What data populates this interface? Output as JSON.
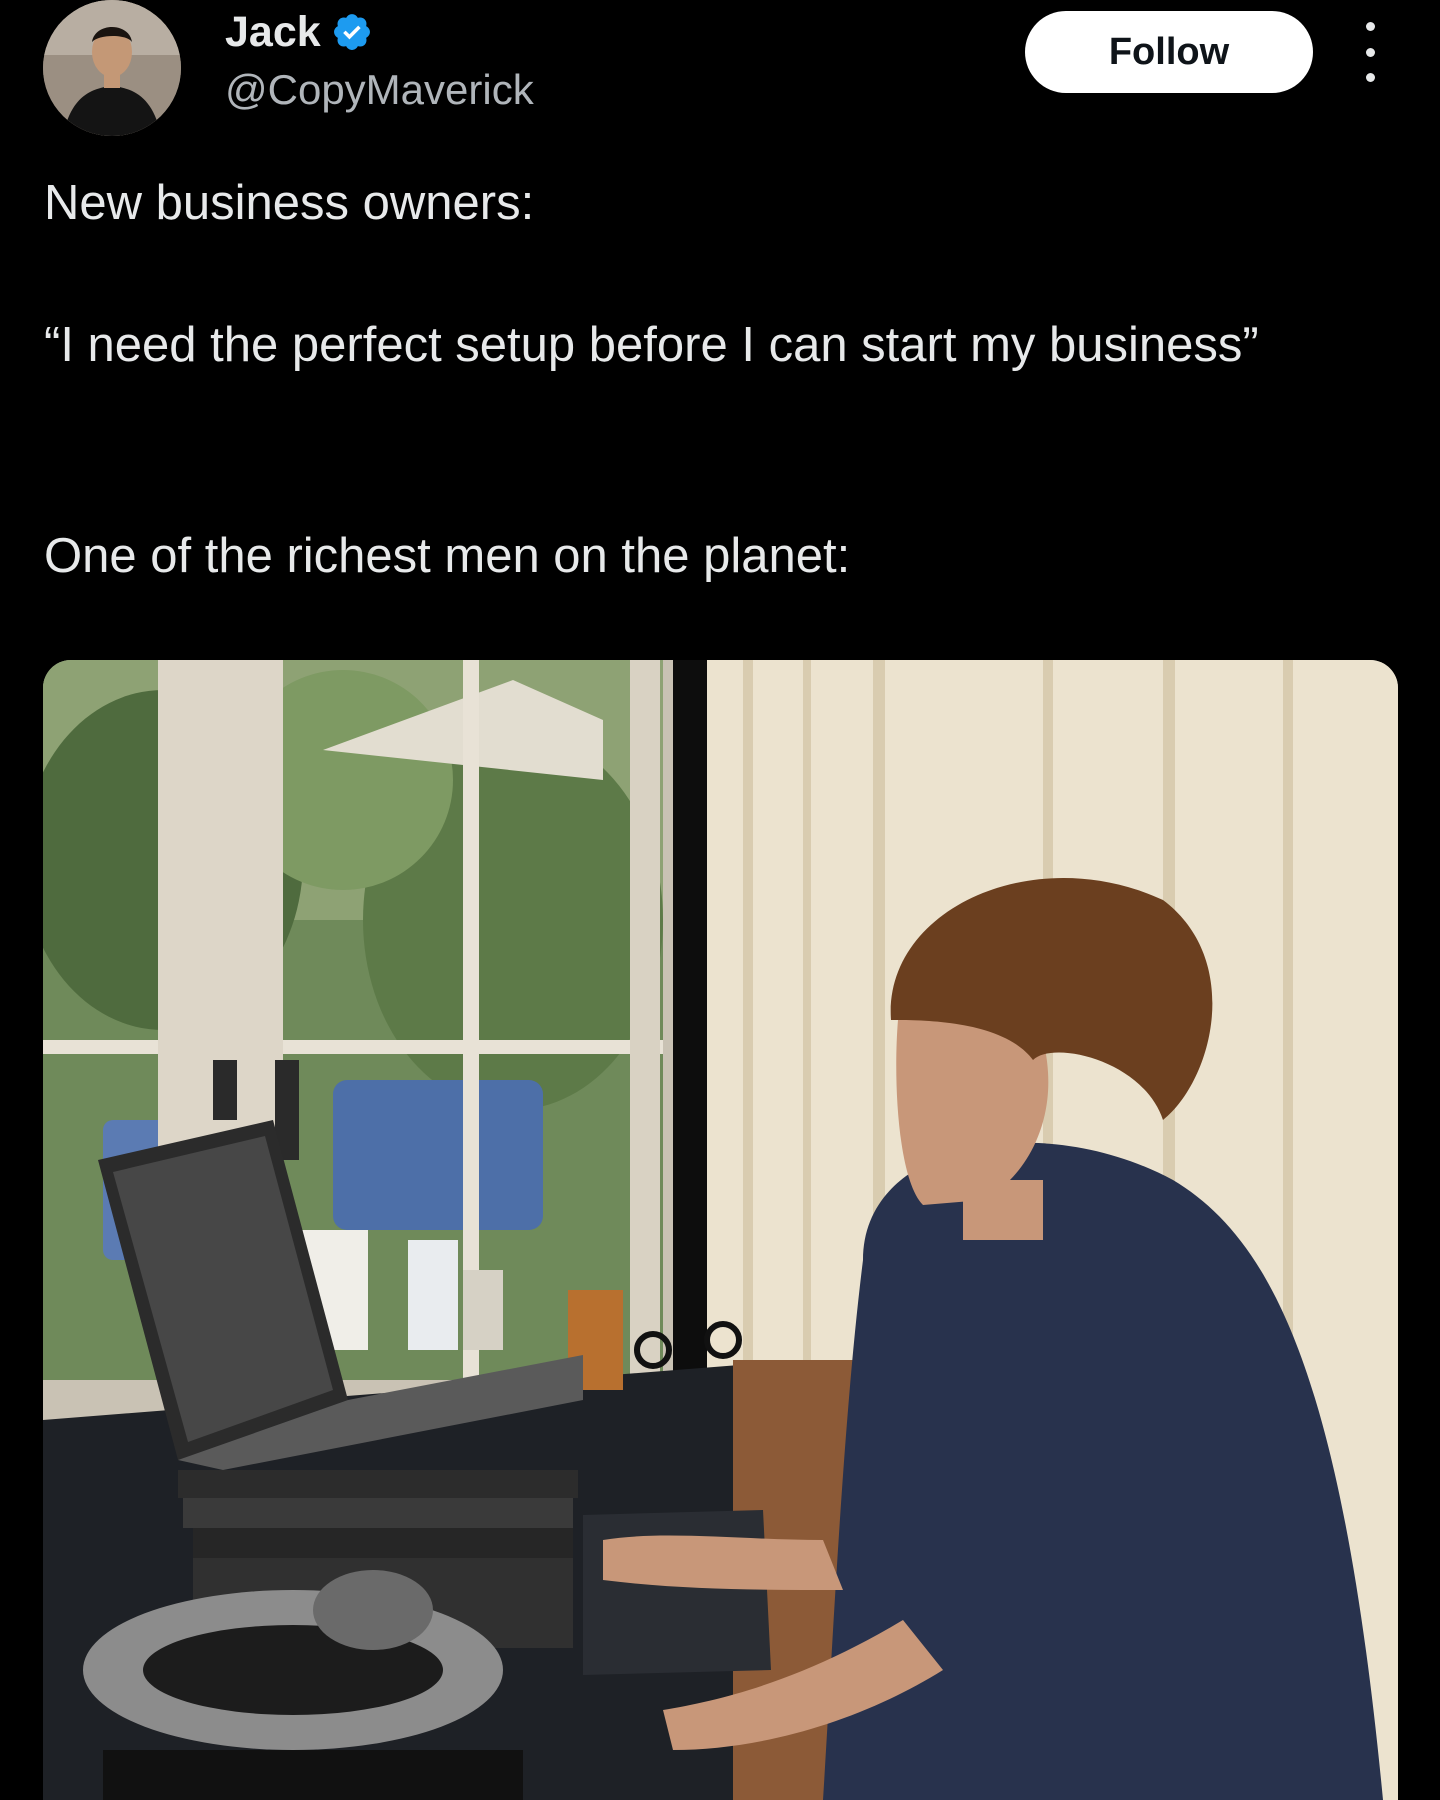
{
  "author": {
    "display_name": "Jack",
    "handle": "@CopyMaverick",
    "verified": true,
    "avatar_icon": "profile-photo"
  },
  "actions": {
    "follow_label": "Follow",
    "more_icon": "more-vertical-icon"
  },
  "tweet": {
    "line1": "New business owners:",
    "line2": "“I need the perfect setup before I can start my business”",
    "line3": "One of the richest men on the planet:"
  },
  "media": {
    "kind": "photo"
  },
  "colors": {
    "background": "#000000",
    "text": "#e7e9ea",
    "muted": "#b0b5ba",
    "verified_blue": "#1d9bf0",
    "follow_bg": "#ffffff"
  }
}
